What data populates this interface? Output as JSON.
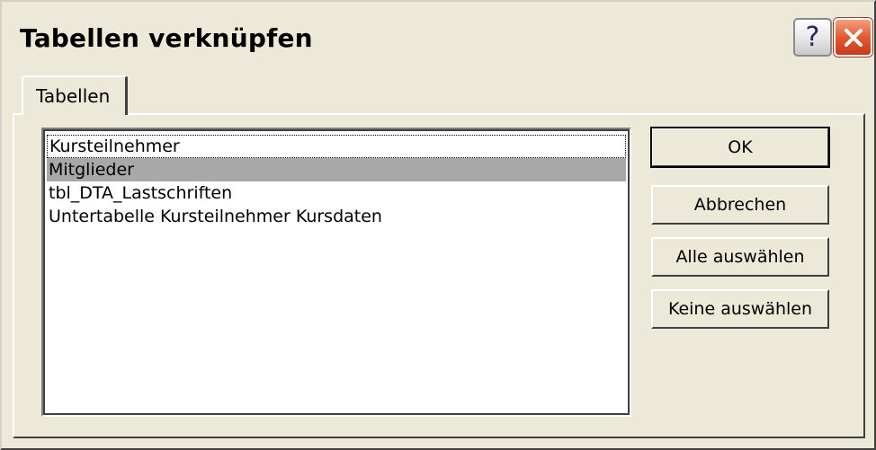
{
  "window": {
    "title": "Tabellen verknüpfen",
    "help_glyph": "?",
    "help_icon": "question-mark-icon",
    "close_icon": "close-x-icon"
  },
  "tabs": [
    {
      "label": "Tabellen",
      "active": true
    }
  ],
  "tables_list": {
    "items": [
      {
        "label": "Kursteilnehmer",
        "selected": false,
        "focused": true
      },
      {
        "label": "Mitglieder",
        "selected": true,
        "focused": false
      },
      {
        "label": "tbl_DTA_Lastschriften",
        "selected": false,
        "focused": false
      },
      {
        "label": "Untertabelle Kursteilnehmer Kursdaten",
        "selected": false,
        "focused": false
      }
    ]
  },
  "buttons": {
    "ok": "OK",
    "cancel": "Abbrechen",
    "select_all": "Alle auswählen",
    "select_none": "Keine auswählen"
  },
  "colors": {
    "dialog_face": "#ece9d8",
    "selection": "#a8a8a8",
    "close_button": "#e25a33"
  }
}
